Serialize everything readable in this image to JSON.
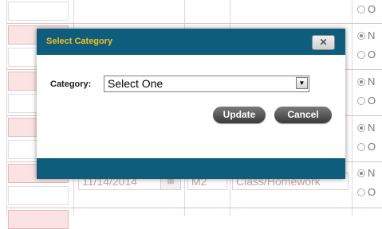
{
  "dialog": {
    "title": "Select Category",
    "close_icon": "close-x-icon",
    "field_label": "Category:",
    "select_value": "Select One",
    "select_arrow_icon": "dropdown-arrow-icon",
    "update_label": "Update",
    "cancel_label": "Cancel",
    "colors": {
      "header": "#0e5d7c",
      "title": "#f3c21d",
      "button": "#4a4a4a"
    }
  },
  "background": {
    "radio_letters": {
      "n": "N",
      "o": "O"
    },
    "row": {
      "date": "11/14/2014",
      "period": "M2",
      "category": "Class/Homework"
    }
  }
}
